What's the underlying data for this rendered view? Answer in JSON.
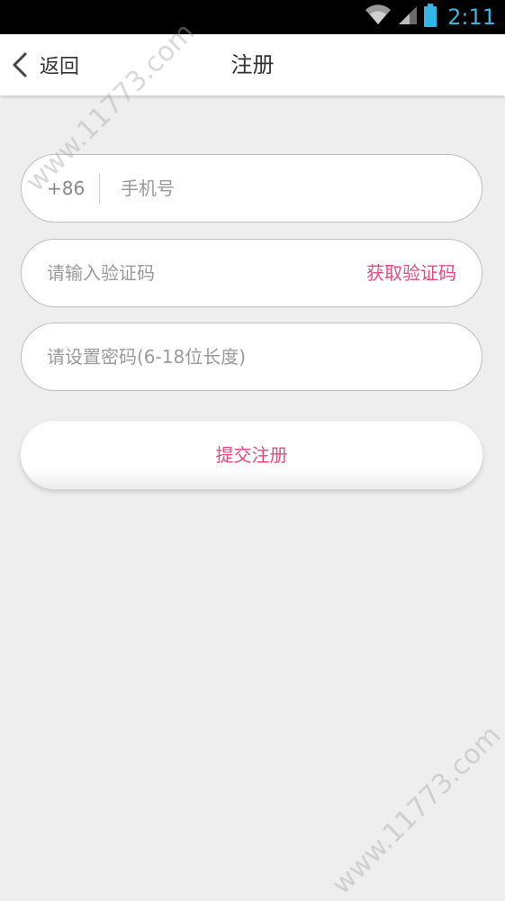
{
  "status_bar": {
    "time": "2:11",
    "icons": [
      "wifi-icon",
      "signal-icon",
      "battery-icon"
    ]
  },
  "header": {
    "back_label": "返回",
    "title": "注册"
  },
  "form": {
    "country_code": "+86",
    "phone_placeholder": "手机号",
    "code_placeholder": "请输入验证码",
    "get_code_label": "获取验证码",
    "password_placeholder": "请设置密码(6-18位长度)",
    "submit_label": "提交注册"
  },
  "watermark": "www.11773.com",
  "colors": {
    "accent": "#e84a7f",
    "status_time": "#33b5e5",
    "background": "#eeeeee"
  }
}
